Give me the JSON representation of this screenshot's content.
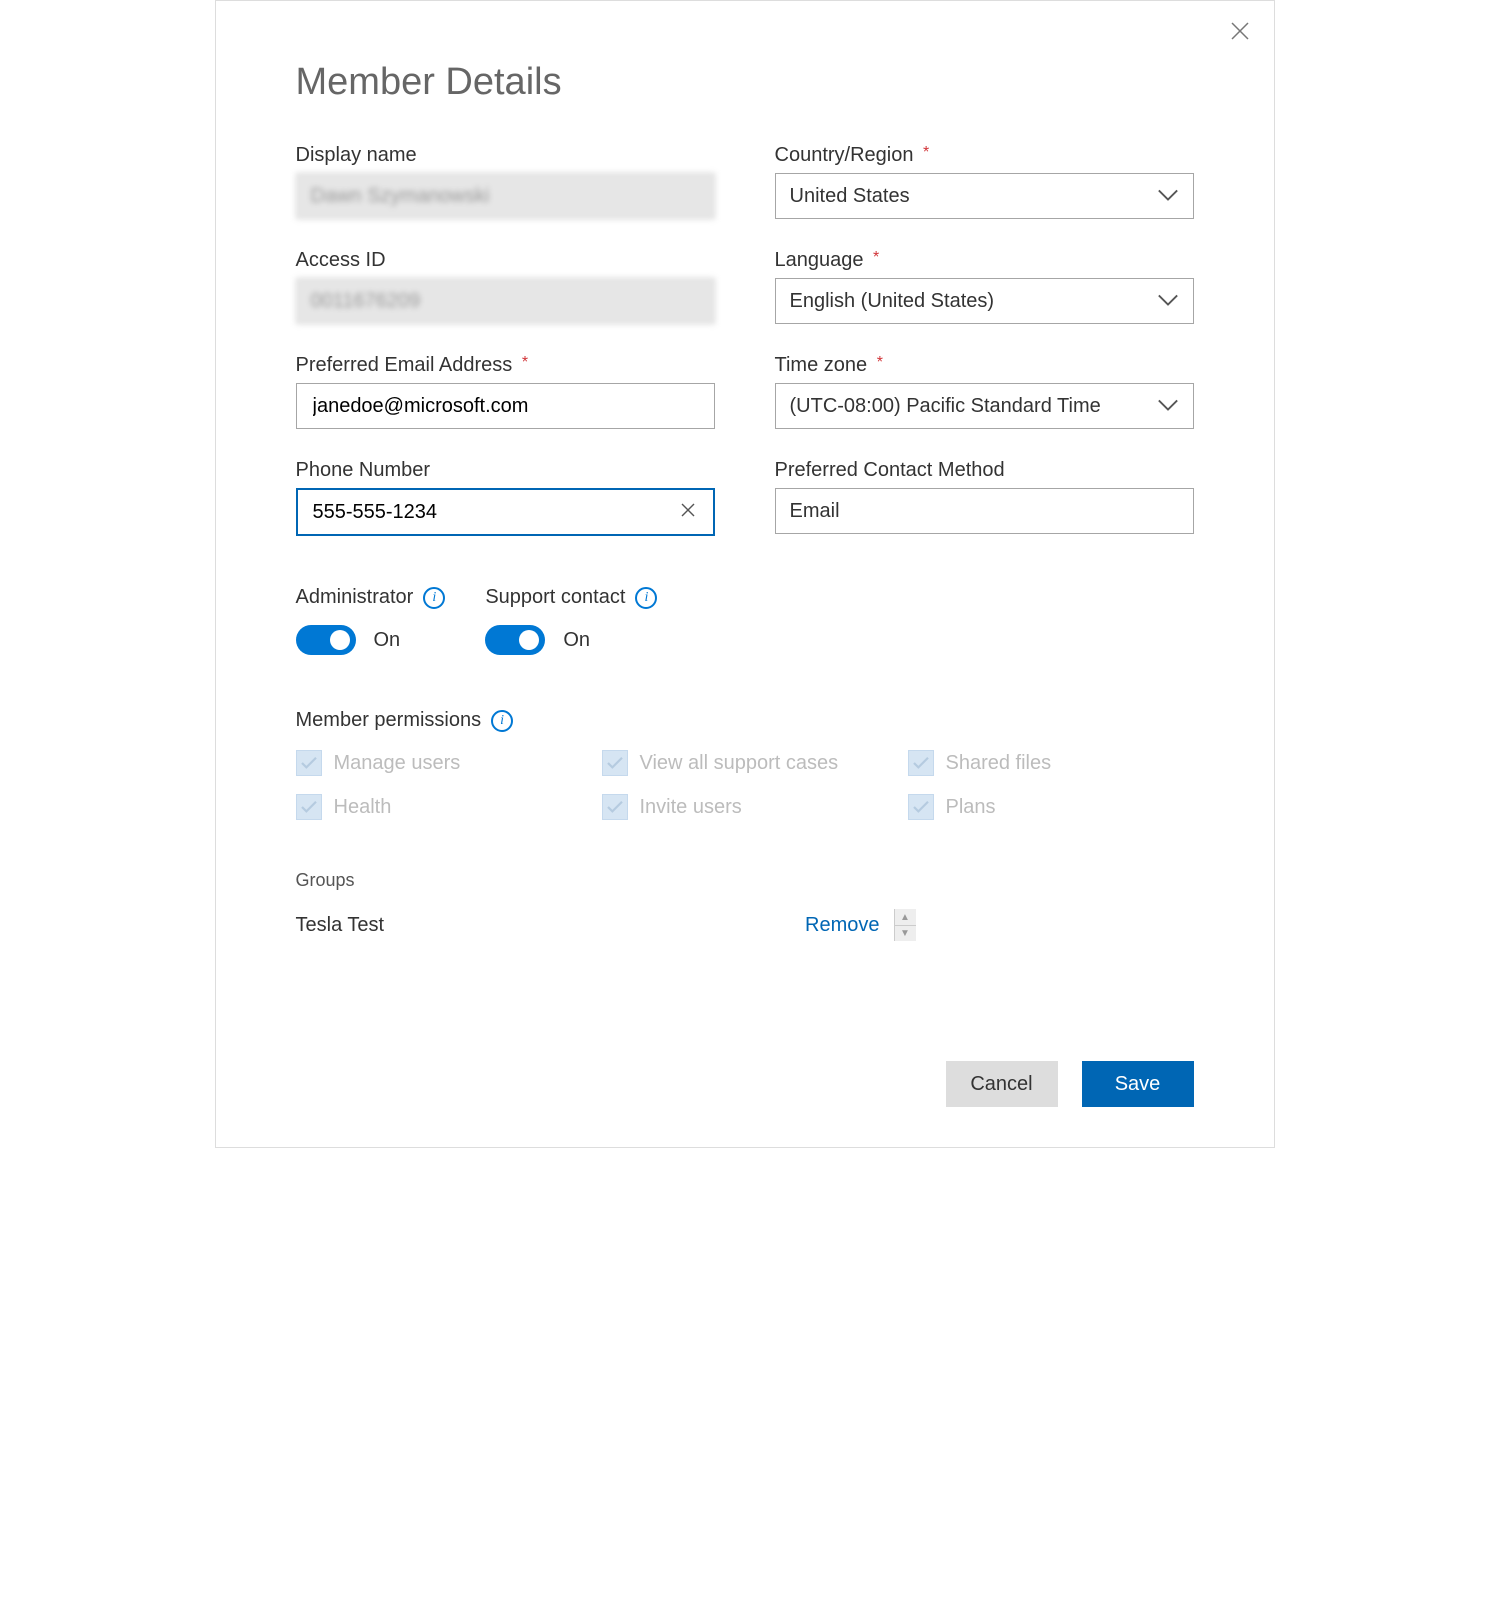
{
  "title": "Member Details",
  "close_icon": "close-icon",
  "fields": {
    "display_name": {
      "label": "Display name",
      "value": "Dawn Szymanowski",
      "disabled": true
    },
    "access_id": {
      "label": "Access ID",
      "value": "0011676209",
      "disabled": true
    },
    "email": {
      "label": "Preferred Email Address",
      "required": true,
      "value": "janedoe@microsoft.com"
    },
    "phone": {
      "label": "Phone Number",
      "value": "555-555-1234",
      "has_clear": true,
      "focused": true
    },
    "country": {
      "label": "Country/Region",
      "required": true,
      "value": "United States"
    },
    "language": {
      "label": "Language",
      "required": true,
      "value": "English (United States)"
    },
    "timezone": {
      "label": "Time zone",
      "required": true,
      "value": "(UTC-08:00) Pacific Standard Time"
    },
    "contact_method": {
      "label": "Preferred Contact Method",
      "value": "Email"
    }
  },
  "toggles": {
    "administrator": {
      "label": "Administrator",
      "state": "On",
      "on": true
    },
    "support_contact": {
      "label": "Support contact",
      "state": "On",
      "on": true
    }
  },
  "permissions": {
    "label": "Member permissions",
    "items": [
      {
        "label": "Manage users",
        "checked": true,
        "disabled": true
      },
      {
        "label": "View all support cases",
        "checked": true,
        "disabled": true
      },
      {
        "label": "Shared files",
        "checked": true,
        "disabled": true
      },
      {
        "label": "Health",
        "checked": true,
        "disabled": true
      },
      {
        "label": "Invite users",
        "checked": true,
        "disabled": true
      },
      {
        "label": "Plans",
        "checked": true,
        "disabled": true
      }
    ]
  },
  "groups": {
    "label": "Groups",
    "items": [
      {
        "name": "Tesla Test",
        "remove_label": "Remove"
      }
    ]
  },
  "buttons": {
    "cancel": "Cancel",
    "save": "Save"
  },
  "required_marker": "*"
}
